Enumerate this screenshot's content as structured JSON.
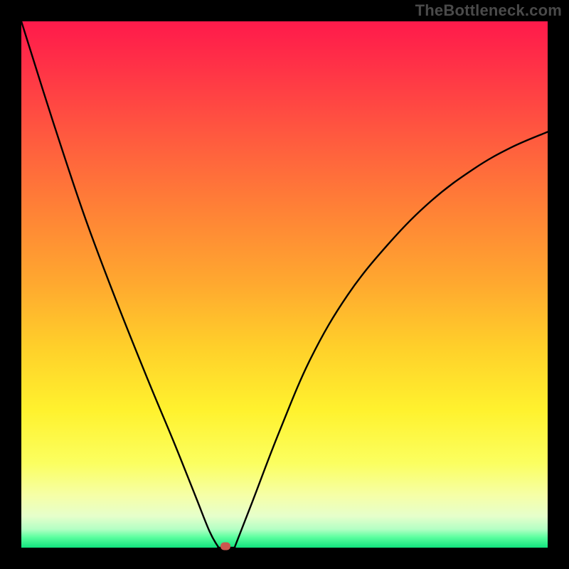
{
  "watermark": "TheBottleneck.com",
  "colors": {
    "background": "#000000",
    "curve": "#000000",
    "dot": "#cc574f"
  },
  "chart_data": {
    "type": "line",
    "title": "",
    "xlabel": "",
    "ylabel": "",
    "axes_visible": false,
    "grid": false,
    "xlim": [
      0,
      1
    ],
    "ylim": [
      0,
      1
    ],
    "marker": {
      "x": 0.388,
      "y": 0.0,
      "color": "#cc574f"
    },
    "series": [
      {
        "name": "left-branch",
        "x": [
          0.0,
          0.06,
          0.12,
          0.18,
          0.24,
          0.29,
          0.33,
          0.358,
          0.375
        ],
        "y": [
          1.0,
          0.81,
          0.63,
          0.47,
          0.32,
          0.2,
          0.1,
          0.03,
          0.0
        ]
      },
      {
        "name": "floor",
        "x": [
          0.375,
          0.405
        ],
        "y": [
          0.0,
          0.0
        ]
      },
      {
        "name": "right-branch",
        "x": [
          0.405,
          0.44,
          0.49,
          0.55,
          0.62,
          0.7,
          0.78,
          0.86,
          0.93,
          1.0
        ],
        "y": [
          0.0,
          0.09,
          0.22,
          0.36,
          0.48,
          0.58,
          0.66,
          0.72,
          0.76,
          0.79
        ]
      }
    ],
    "background_gradient": [
      {
        "stop": 0.0,
        "color": "#ff1a4b"
      },
      {
        "stop": 0.5,
        "color": "#ffa92f"
      },
      {
        "stop": 0.74,
        "color": "#fff22e"
      },
      {
        "stop": 0.96,
        "color": "#b3ffc4"
      },
      {
        "stop": 1.0,
        "color": "#11e27d"
      }
    ]
  }
}
